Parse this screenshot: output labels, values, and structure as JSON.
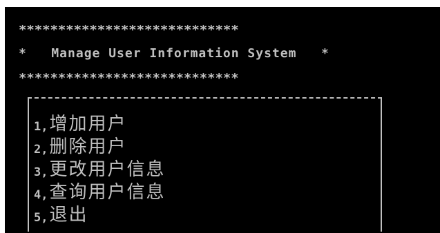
{
  "console": {
    "background": "#000000",
    "text_color": "#c0c0c0",
    "banner": {
      "top_border": "****************************",
      "title_line": "*   Manage User Information System   *",
      "bottom_border": "****************************"
    },
    "menu": {
      "items": [
        {
          "number": "1,",
          "label": "增加用户"
        },
        {
          "number": "2,",
          "label": "删除用户"
        },
        {
          "number": "3,",
          "label": "更改用户信息"
        },
        {
          "number": "4,",
          "label": "查询用户信息"
        },
        {
          "number": "5,",
          "label": "退出"
        }
      ]
    }
  }
}
